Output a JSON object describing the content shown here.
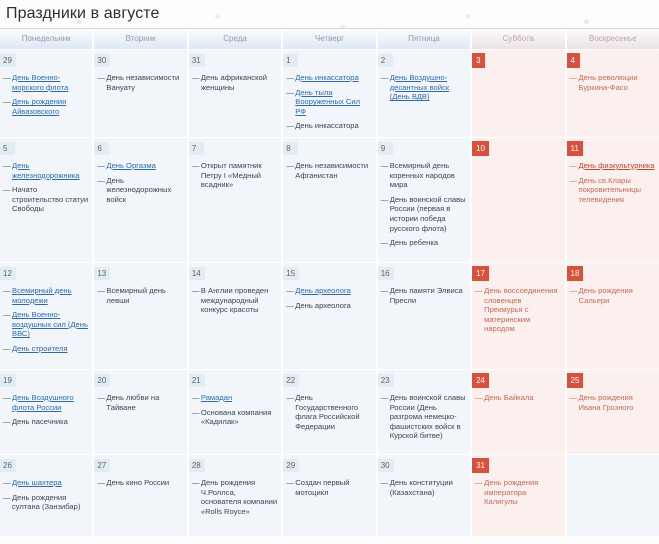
{
  "page_title": "Праздники в августе",
  "weekdays": [
    {
      "label": "Понедельник",
      "weekend": false
    },
    {
      "label": "Вторник",
      "weekend": false
    },
    {
      "label": "Среда",
      "weekend": false
    },
    {
      "label": "Четверг",
      "weekend": false
    },
    {
      "label": "Пятница",
      "weekend": false
    },
    {
      "label": "Суббота",
      "weekend": true
    },
    {
      "label": "Воскресенье",
      "weekend": true
    }
  ],
  "colors": {
    "weekend_badge": "#d9503c",
    "weekday_badge": "#e3ebf3",
    "link": "#2b6cb0",
    "weekend_link": "#c6442c",
    "weekday_cell_bg": "#f2f6fa",
    "weekend_cell_bg": "#fbf0ed"
  },
  "weeks": [
    [
      {
        "day": "29",
        "weekend": false,
        "events": [
          {
            "text": "День Военно-морского флота",
            "link": true
          },
          {
            "text": "День рождения Айвазовского",
            "link": true
          }
        ]
      },
      {
        "day": "30",
        "weekend": false,
        "events": [
          {
            "text": "День независимости Вануату",
            "link": false
          }
        ]
      },
      {
        "day": "31",
        "weekend": false,
        "events": [
          {
            "text": "День африканской женщины",
            "link": false
          }
        ]
      },
      {
        "day": "1",
        "weekend": false,
        "events": [
          {
            "text": "День инкассатора",
            "link": true
          },
          {
            "text": "День тыла Вооруженных Сил РФ",
            "link": true
          },
          {
            "text": "День инкассатора",
            "link": false
          }
        ]
      },
      {
        "day": "2",
        "weekend": false,
        "events": [
          {
            "text": "День Воздушно-десантных войск (День ВДВ)",
            "link": true
          }
        ]
      },
      {
        "day": "3",
        "weekend": true,
        "events": []
      },
      {
        "day": "4",
        "weekend": true,
        "events": [
          {
            "text": "День революции Буркина-Фасо",
            "link": false
          }
        ]
      }
    ],
    [
      {
        "day": "5",
        "weekend": false,
        "events": [
          {
            "text": "День железнодорожника",
            "link": true
          },
          {
            "text": "Начато строительство статуи Свободы",
            "link": false
          }
        ]
      },
      {
        "day": "6",
        "weekend": false,
        "events": [
          {
            "text": "День Оргазма",
            "link": true
          },
          {
            "text": "День железнодорожных войск",
            "link": false
          }
        ]
      },
      {
        "day": "7",
        "weekend": false,
        "events": [
          {
            "text": "Открыт памятник Петру I «Медный всадник»",
            "link": false
          }
        ]
      },
      {
        "day": "8",
        "weekend": false,
        "events": [
          {
            "text": "День независимости Афганистан",
            "link": false
          }
        ]
      },
      {
        "day": "9",
        "weekend": false,
        "events": [
          {
            "text": "Всемирный день коренных народов мира",
            "link": false
          },
          {
            "text": "День воинской славы России (первая в истории победа русского флота)",
            "link": false
          },
          {
            "text": "День ребенка",
            "link": false
          }
        ]
      },
      {
        "day": "10",
        "weekend": true,
        "events": []
      },
      {
        "day": "11",
        "weekend": true,
        "events": [
          {
            "text": "День физкультурника",
            "link": true
          },
          {
            "text": "День св.Клары покровительницы телевидения",
            "link": false
          }
        ]
      }
    ],
    [
      {
        "day": "12",
        "weekend": false,
        "events": [
          {
            "text": "Всемирный день молодежи",
            "link": true
          },
          {
            "text": "День Военно-воздушных сил (День ВВС)",
            "link": true
          },
          {
            "text": "День строителя",
            "link": true
          }
        ]
      },
      {
        "day": "13",
        "weekend": false,
        "events": [
          {
            "text": "Всемирный день левши",
            "link": false
          }
        ]
      },
      {
        "day": "14",
        "weekend": false,
        "events": [
          {
            "text": "В Англии проведен международный конкурс красоты",
            "link": false
          }
        ]
      },
      {
        "day": "15",
        "weekend": false,
        "events": [
          {
            "text": "День археолога",
            "link": true
          },
          {
            "text": "День археолога",
            "link": false
          }
        ]
      },
      {
        "day": "16",
        "weekend": false,
        "events": [
          {
            "text": "День памяти Элвиса Пресли",
            "link": false
          }
        ]
      },
      {
        "day": "17",
        "weekend": true,
        "events": [
          {
            "text": "День воссоединения словенцев Прекмурья с материнским народом",
            "link": false
          }
        ]
      },
      {
        "day": "18",
        "weekend": true,
        "events": [
          {
            "text": "День рождения Сальери",
            "link": false
          }
        ]
      }
    ],
    [
      {
        "day": "19",
        "weekend": false,
        "events": [
          {
            "text": "День Воздушного флота России",
            "link": true
          },
          {
            "text": "День пасечника",
            "link": false
          }
        ]
      },
      {
        "day": "20",
        "weekend": false,
        "events": [
          {
            "text": "День любви на Тайване",
            "link": false
          }
        ]
      },
      {
        "day": "21",
        "weekend": false,
        "events": [
          {
            "text": "Рамадан",
            "link": true
          },
          {
            "text": "Основана компания «Кадилак»",
            "link": false
          }
        ]
      },
      {
        "day": "22",
        "weekend": false,
        "events": [
          {
            "text": "День Государственного флага Российской Федерации",
            "link": false
          }
        ]
      },
      {
        "day": "23",
        "weekend": false,
        "events": [
          {
            "text": "День воинской славы России (День разгрома немецко-фашистских войск в Курской битве)",
            "link": false
          }
        ]
      },
      {
        "day": "24",
        "weekend": true,
        "events": [
          {
            "text": "День Байкала",
            "link": false
          }
        ]
      },
      {
        "day": "25",
        "weekend": true,
        "events": [
          {
            "text": "День рождения Ивана Грозного",
            "link": false
          }
        ]
      }
    ],
    [
      {
        "day": "26",
        "weekend": false,
        "events": [
          {
            "text": "День шахтера",
            "link": true
          },
          {
            "text": "День рождения султана (Занзибар)",
            "link": false
          }
        ]
      },
      {
        "day": "27",
        "weekend": false,
        "events": [
          {
            "text": "День кино России",
            "link": false
          }
        ]
      },
      {
        "day": "28",
        "weekend": false,
        "events": [
          {
            "text": "День рождения Ч.Роллса, основателя компании «Rolls Royce»",
            "link": false
          }
        ]
      },
      {
        "day": "29",
        "weekend": false,
        "events": [
          {
            "text": "Создан первый мотоцикл",
            "link": false
          }
        ]
      },
      {
        "day": "30",
        "weekend": false,
        "events": [
          {
            "text": "День конституции (Казахстана)",
            "link": false
          }
        ]
      },
      {
        "day": "31",
        "weekend": true,
        "events": [
          {
            "text": "День рождения императора Калигулы",
            "link": false
          }
        ]
      },
      {
        "day": "",
        "weekend": false,
        "empty": true,
        "events": []
      }
    ]
  ]
}
